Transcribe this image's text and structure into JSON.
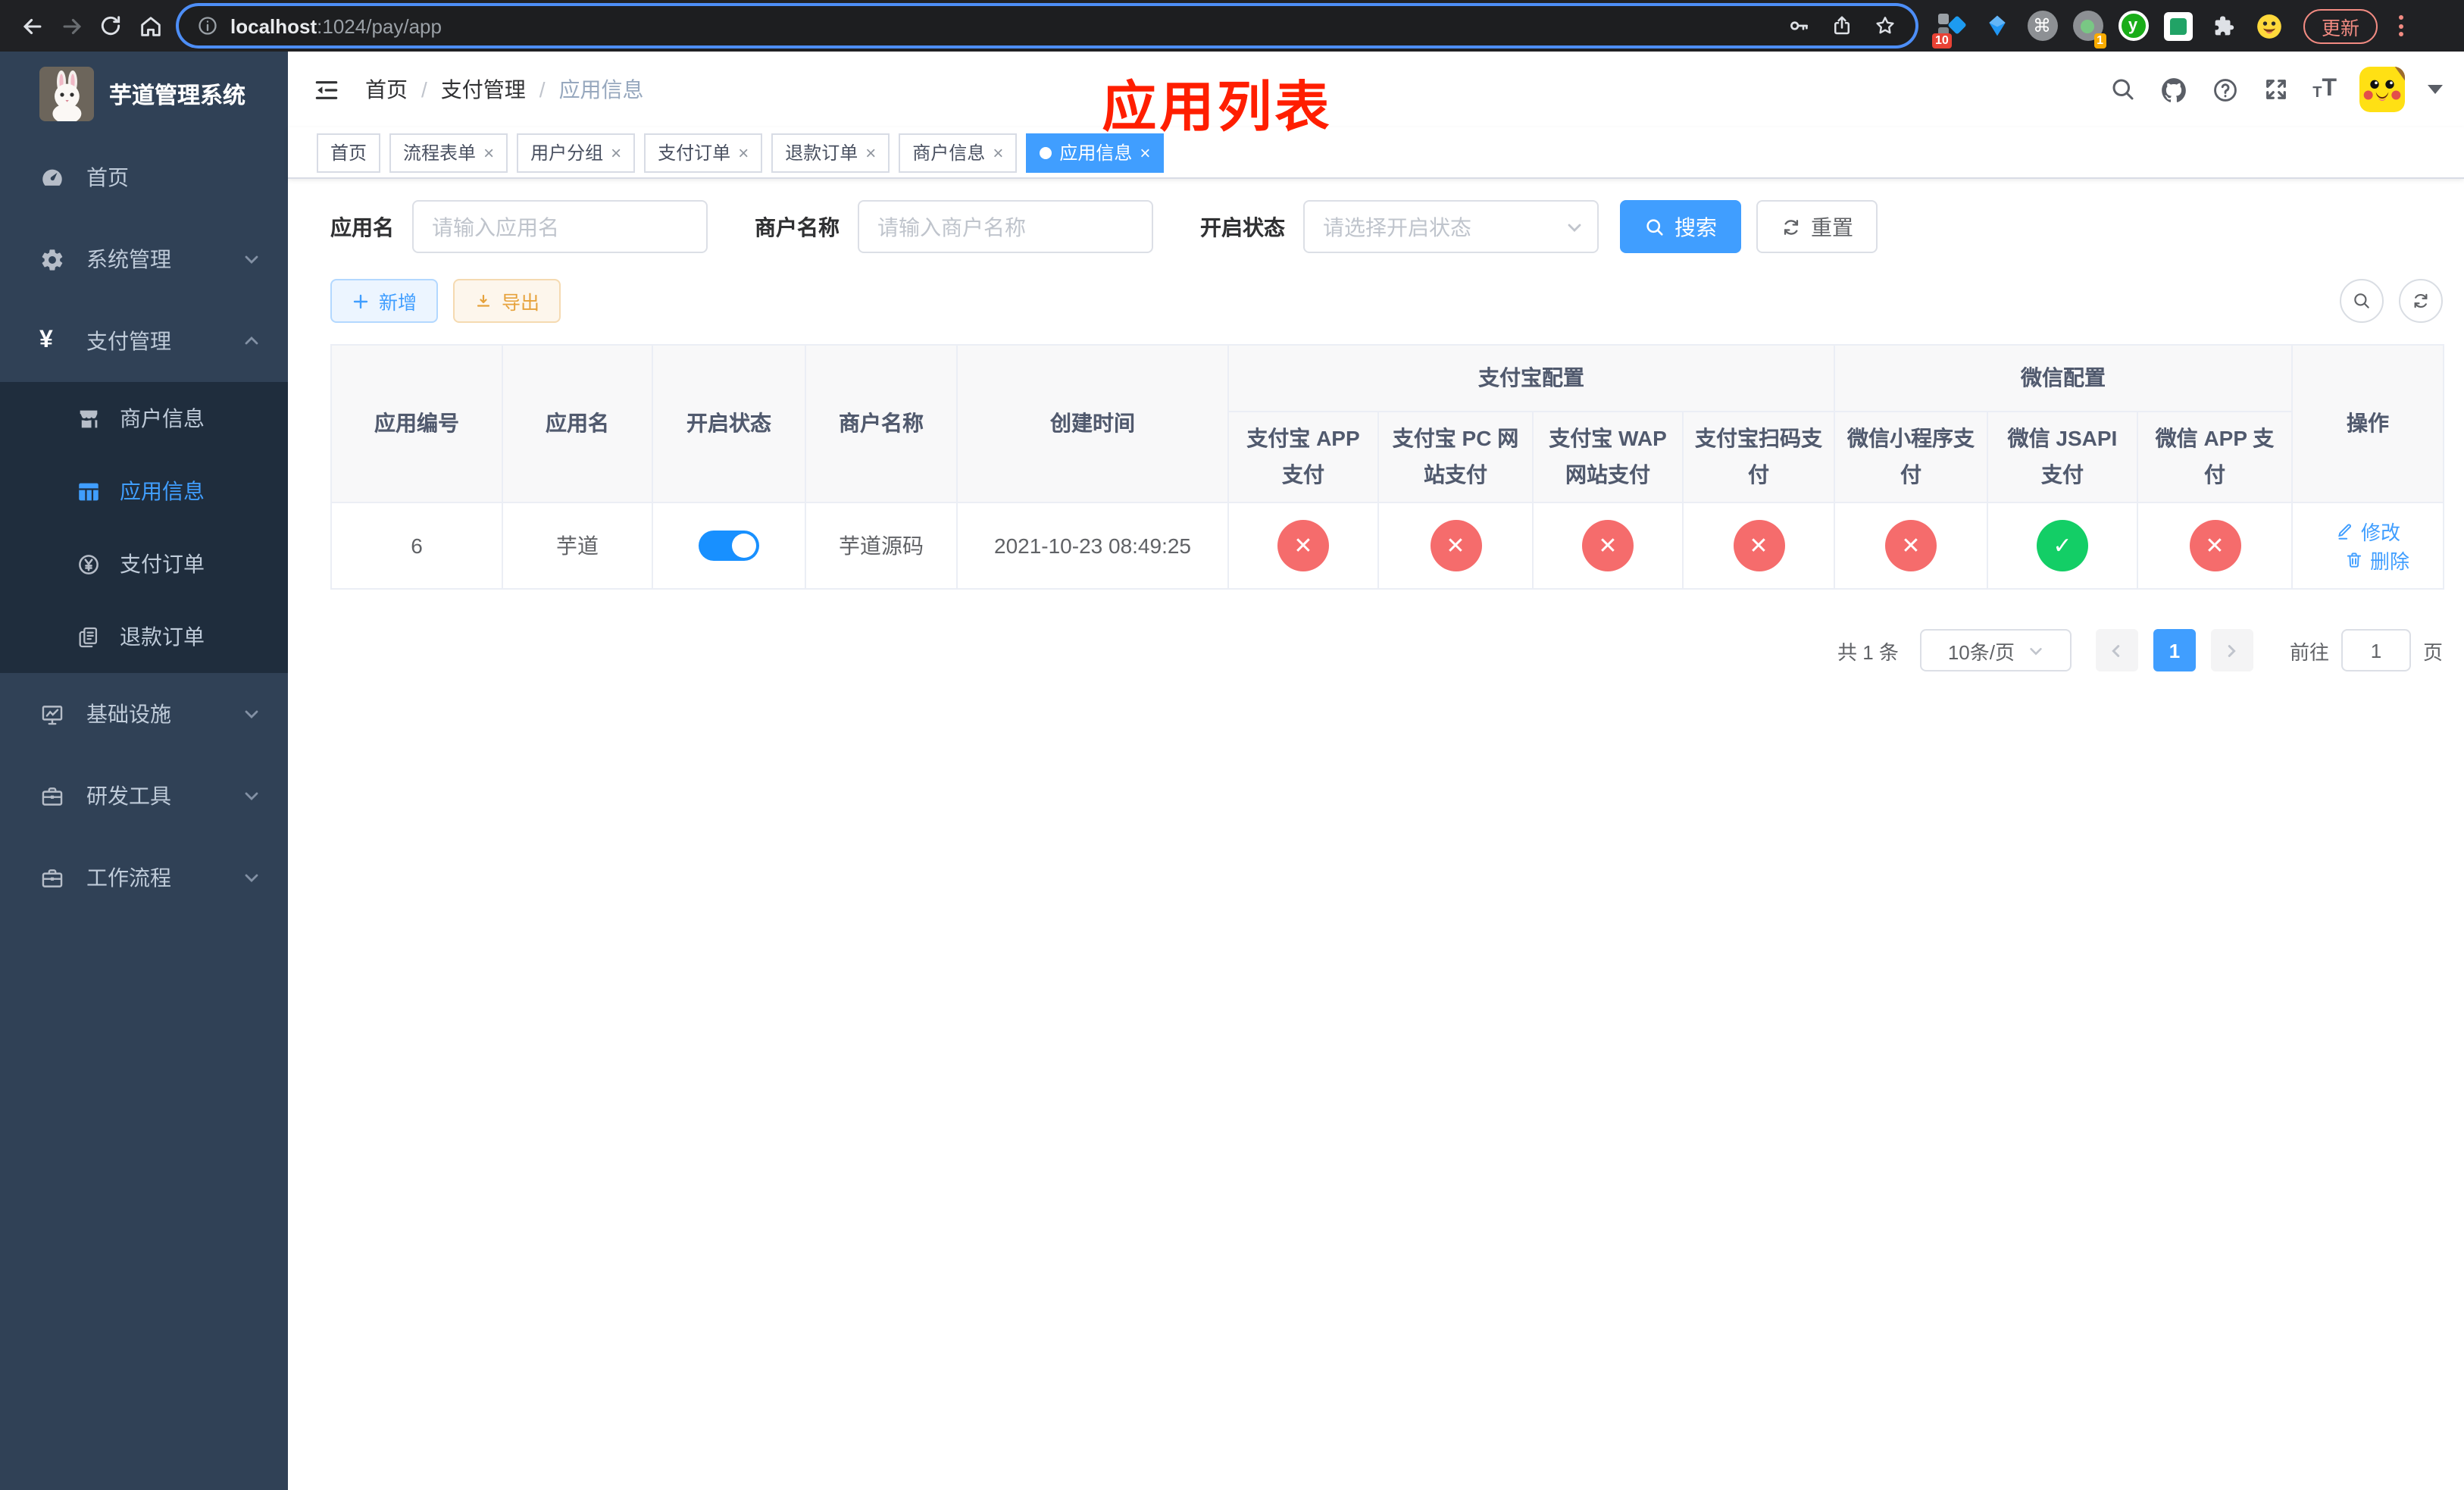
{
  "browser": {
    "url_host": "localhost",
    "url_path": ":1024/pay/app",
    "update_label": "更新",
    "ext_badges": {
      "translate": "10",
      "recorder": "1"
    }
  },
  "sidebar": {
    "title": "芋道管理系统",
    "top_items": [
      {
        "label": "首页"
      },
      {
        "label": "系统管理"
      },
      {
        "label": "支付管理"
      }
    ],
    "pay_subitems": [
      {
        "label": "商户信息"
      },
      {
        "label": "应用信息"
      },
      {
        "label": "支付订单"
      },
      {
        "label": "退款订单"
      }
    ],
    "bottom_items": [
      {
        "label": "基础设施"
      },
      {
        "label": "研发工具"
      },
      {
        "label": "工作流程"
      }
    ]
  },
  "header": {
    "breadcrumb": [
      {
        "label": "首页"
      },
      {
        "label": "支付管理"
      },
      {
        "label": "应用信息"
      }
    ],
    "separator": "/",
    "annotation": "应用列表"
  },
  "tabs": [
    {
      "label": "首页"
    },
    {
      "label": "流程表单"
    },
    {
      "label": "用户分组"
    },
    {
      "label": "支付订单"
    },
    {
      "label": "退款订单"
    },
    {
      "label": "商户信息"
    },
    {
      "label": "应用信息"
    }
  ],
  "filters": {
    "app_name_label": "应用名",
    "app_name_placeholder": "请输入应用名",
    "merchant_label": "商户名称",
    "merchant_placeholder": "请输入商户名称",
    "status_label": "开启状态",
    "status_placeholder": "请选择开启状态",
    "search_label": "搜索",
    "reset_label": "重置"
  },
  "toolbar": {
    "add_label": "新增",
    "export_label": "导出"
  },
  "table": {
    "group_headers": {
      "alipay": "支付宝配置",
      "wechat": "微信配置"
    },
    "columns": [
      "应用编号",
      "应用名",
      "开启状态",
      "商户名称",
      "创建时间",
      "支付宝 APP 支付",
      "支付宝 PC 网站支付",
      "支付宝 WAP 网站支付",
      "支付宝扫码支付",
      "微信小程序支付",
      "微信 JSAPI 支付",
      "微信 APP 支付",
      "操作"
    ],
    "row": {
      "id": "6",
      "name": "芋道",
      "enabled": true,
      "merchant": "芋道源码",
      "created_at": "2021-10-23 08:49:25",
      "channel_enabled": [
        false,
        false,
        false,
        false,
        false,
        true,
        false
      ],
      "edit_label": "修改",
      "delete_label": "删除"
    }
  },
  "pagination": {
    "total_text": "共 1 条",
    "page_size": "10条/页",
    "current_page": "1",
    "goto_label": "前往",
    "goto_value": "1",
    "page_unit": "页"
  },
  "colors": {
    "primary": "#409eff",
    "danger": "#f56c6c",
    "success": "#13ce66",
    "warning_text": "#e6a23c",
    "annotation_red": "#ff1e00",
    "sidebar_bg": "#304156",
    "submenu_bg": "#1f2d3d"
  }
}
